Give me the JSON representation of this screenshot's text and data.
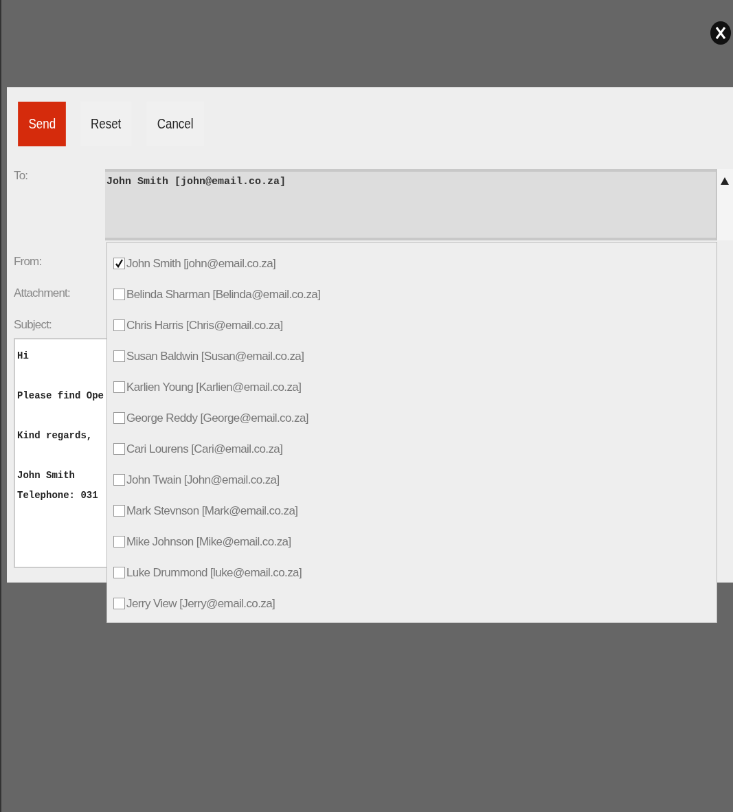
{
  "toolbar": {
    "buttons": [
      {
        "label": "Send",
        "kind": "primary"
      },
      {
        "label": "Reset",
        "kind": "plain"
      },
      {
        "label": "Cancel",
        "kind": "plain"
      }
    ]
  },
  "form": {
    "to": {
      "label": "To:",
      "value": "John Smith [john@email.co.za]"
    },
    "labels": [
      "From:",
      "Attachment:",
      "Subject:"
    ],
    "message": [
      [
        "Hi"
      ],
      [
        "Please find Ope"
      ],
      [
        "Kind regards,"
      ],
      [
        "John Smith",
        "Telephone: 031"
      ]
    ]
  },
  "recipients": [
    {
      "label": "John Smith [john@email.co.za]",
      "checked": true
    },
    {
      "label": "Belinda Sharman [Belinda@email.co.za]",
      "checked": false
    },
    {
      "label": "Chris Harris [Chris@email.co.za]",
      "checked": false
    },
    {
      "label": "Susan Baldwin [Susan@email.co.za]",
      "checked": false
    },
    {
      "label": "Karlien Young [Karlien@email.co.za]",
      "checked": false
    },
    {
      "label": "George Reddy [George@email.co.za]",
      "checked": false
    },
    {
      "label": "Cari Lourens [Cari@email.co.za]",
      "checked": false
    },
    {
      "label": "John Twain [John@email.co.za]",
      "checked": false
    },
    {
      "label": "Mark Stevnson [Mark@email.co.za]",
      "checked": false
    },
    {
      "label": "Mike Johnson [Mike@email.co.za]",
      "checked": false
    },
    {
      "label": "Luke Drummond [luke@email.co.za]",
      "checked": false
    },
    {
      "label": "Jerry View [Jerry@email.co.za]",
      "checked": false
    }
  ]
}
